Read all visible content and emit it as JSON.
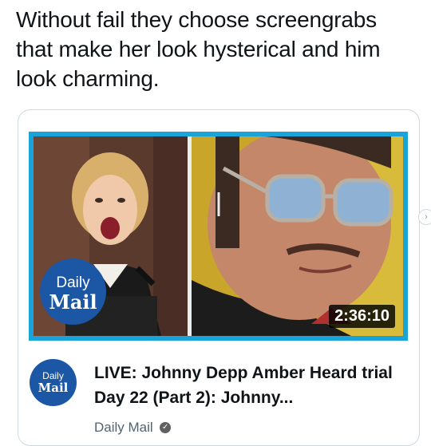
{
  "tweet": {
    "text": "Without fail they choose screengrabs that make her look hysterical and him look charming."
  },
  "video_card": {
    "thumbnail": {
      "logo_daily": "Daily",
      "logo_mail": "Mail",
      "duration": "2:36:10"
    },
    "channel_logo": {
      "daily": "Daily",
      "mail": "Mail"
    },
    "title": "LIVE: Johnny Depp Amber Heard trial Day 22 (Part 2): Johnny...",
    "channel": "Daily Mail",
    "verified_icon": "check-circle-icon",
    "nav_icon": "chevron-right-icon"
  },
  "colors": {
    "thumbnail_border": "#1aa3d9",
    "daily_mail_blue": "#1c57a5"
  }
}
